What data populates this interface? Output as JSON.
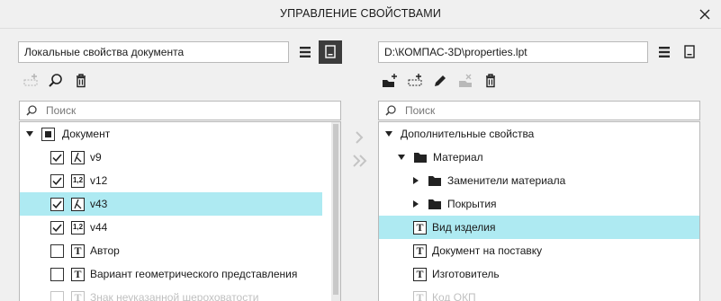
{
  "window": {
    "title": "УПРАВЛЕНИЕ СВОЙСТВАМИ"
  },
  "left": {
    "source_field": "Локальные свойства документа",
    "search_placeholder": "Поиск",
    "tree": {
      "root": "Документ",
      "items": [
        {
          "label": "v9",
          "checked": true,
          "icon": "lambda-icon"
        },
        {
          "label": "v12",
          "checked": true,
          "icon": "number-icon"
        },
        {
          "label": "v43",
          "checked": true,
          "icon": "lambda-icon",
          "selected": true
        },
        {
          "label": "v44",
          "checked": true,
          "icon": "number-icon"
        },
        {
          "label": "Автор",
          "checked": false,
          "icon": "text-icon"
        },
        {
          "label": "Вариант геометрического представления",
          "checked": false,
          "icon": "text-icon"
        },
        {
          "label": "Знак неуказанной шероховатости",
          "checked": false,
          "icon": "text-icon",
          "faded": true
        }
      ]
    }
  },
  "right": {
    "source_field": "D:\\КОМПАС-3D\\properties.lpt",
    "search_placeholder": "Поиск",
    "tree": {
      "root": "Дополнительные свойства",
      "folder": "Материал",
      "subfolders": [
        "Заменители материала",
        "Покрытия"
      ],
      "items": [
        {
          "label": "Вид изделия",
          "selected": true
        },
        {
          "label": "Документ на поставку"
        },
        {
          "label": "Изготовитель"
        },
        {
          "label": "Код ОКП",
          "faded": true
        }
      ]
    }
  },
  "colors": {
    "selection": "#aeeaf2",
    "active_button": "#3c3c3c"
  }
}
